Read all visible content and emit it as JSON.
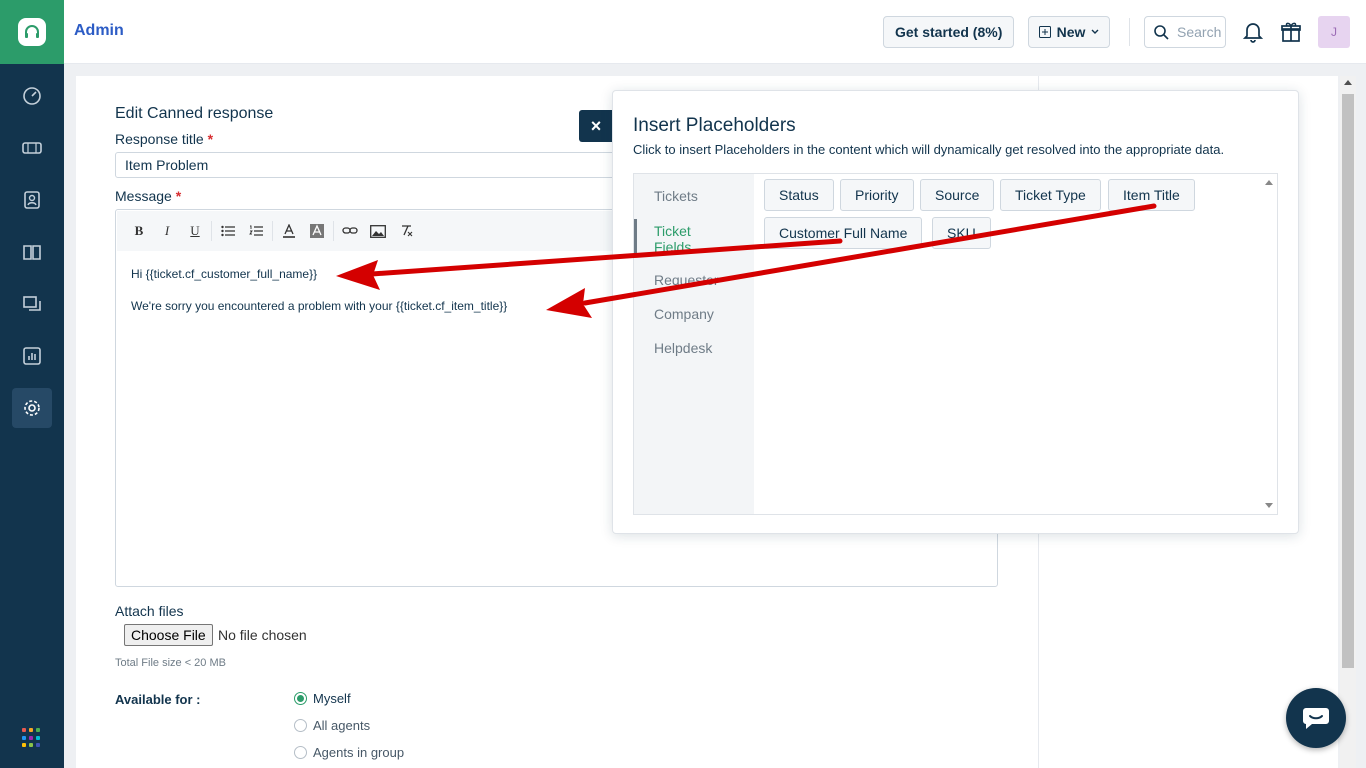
{
  "header": {
    "title": "Admin",
    "get_started": "Get started (8%)",
    "new_label": "New",
    "search_placeholder": "Search",
    "avatar_initial": "J"
  },
  "form": {
    "heading": "Edit Canned response",
    "response_title_label": "Response title",
    "required_mark": "*",
    "response_title_value": "Item Problem",
    "message_label": "Message",
    "toolbar": [
      "B",
      "I",
      "U"
    ],
    "body_lines": [
      "Hi {{ticket.cf_customer_full_name}}",
      "We're sorry you encountered a problem with your {{ticket.cf_item_title}}"
    ],
    "attach_label": "Attach files",
    "choose_file": "Choose File",
    "no_file": "No file chosen",
    "file_size_note": "Total File size < 20 MB",
    "available_for_label": "Available for :",
    "available_options": [
      {
        "label": "Myself",
        "checked": true
      },
      {
        "label": "All agents",
        "checked": false
      },
      {
        "label": "Agents in group",
        "checked": false
      }
    ]
  },
  "placeholders": {
    "close_label": "×",
    "title": "Insert Placeholders",
    "description": "Click to insert Placeholders in the content which will dynamically get resolved into the appropriate data.",
    "categories": [
      {
        "label": "Tickets",
        "active": false
      },
      {
        "label": "Ticket Fields",
        "active": true
      },
      {
        "label": "Requester",
        "active": false
      },
      {
        "label": "Company",
        "active": false
      },
      {
        "label": "Helpdesk",
        "active": false
      }
    ],
    "chips": [
      "Status",
      "Priority",
      "Source",
      "Ticket Type",
      "Item Title",
      "Customer Full Name",
      "SKU"
    ]
  },
  "colors": {
    "sidebar": "#12344d",
    "brand_green": "#2c9c6a",
    "arrow_red": "#e00000"
  }
}
